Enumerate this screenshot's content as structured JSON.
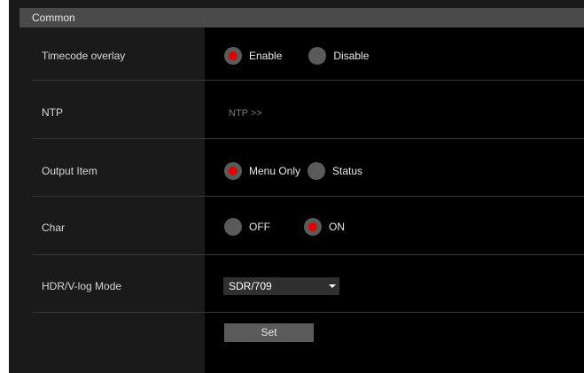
{
  "section": {
    "title": "Common"
  },
  "rows": {
    "timecode_overlay": {
      "label": "Timecode overlay",
      "options": [
        {
          "label": "Enable",
          "selected": true
        },
        {
          "label": "Disable",
          "selected": false
        }
      ]
    },
    "ntp": {
      "label": "NTP",
      "link": "NTP >>"
    },
    "output_item": {
      "label": "Output Item",
      "options": [
        {
          "label": "Menu Only",
          "selected": true
        },
        {
          "label": "Status",
          "selected": false
        }
      ]
    },
    "char": {
      "label": "Char",
      "options": [
        {
          "label": "OFF",
          "selected": false
        },
        {
          "label": "ON",
          "selected": true
        }
      ]
    },
    "hdr_mode": {
      "label": "HDR/V-log Mode",
      "value": "SDR/709"
    }
  },
  "actions": {
    "set_label": "Set"
  },
  "colors": {
    "selected_dot": "#e00000",
    "radio_bg": "#5a5a5a",
    "panel_bg": "#000000",
    "label_bg": "#1a1a1a",
    "header_bg": "#4a4a4a"
  }
}
